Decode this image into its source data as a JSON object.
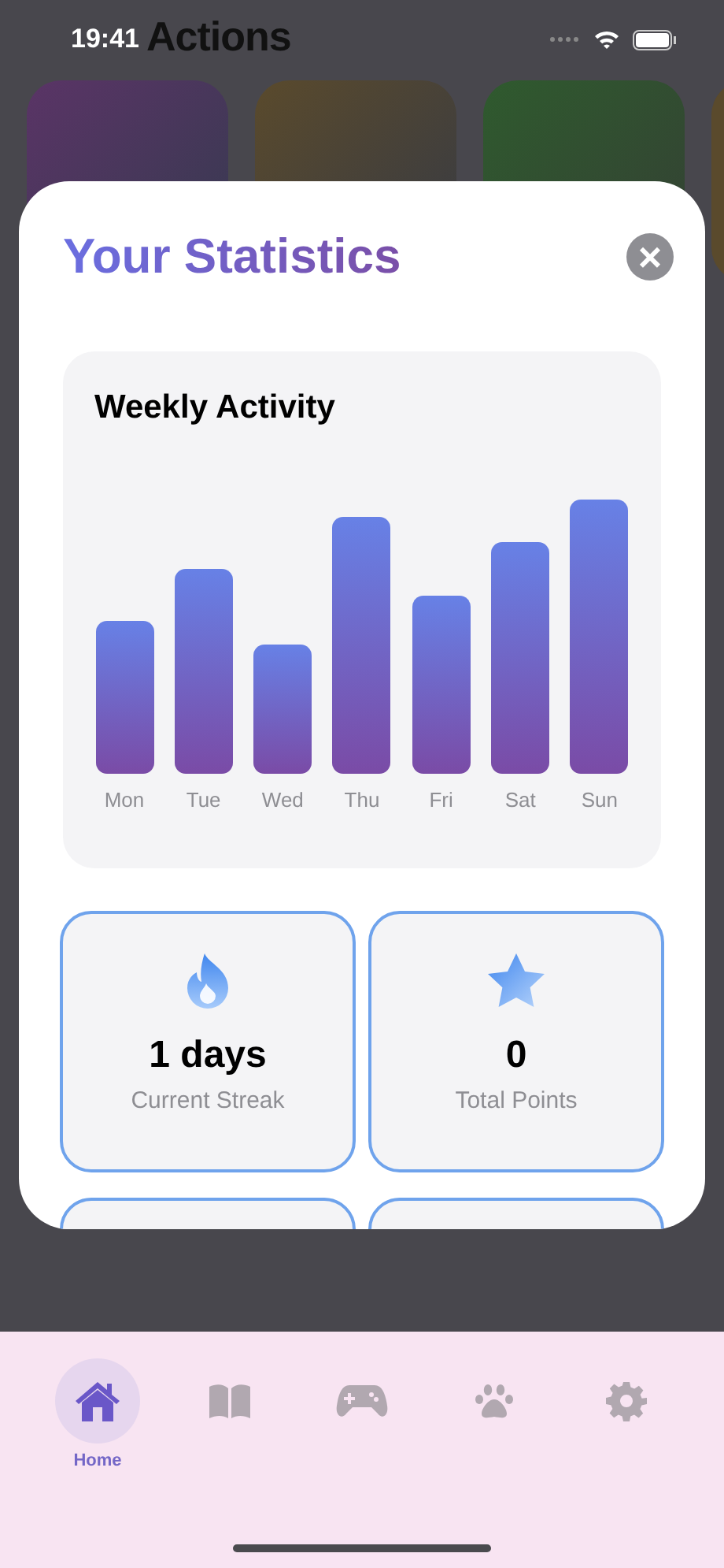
{
  "background": {
    "title": "Actions"
  },
  "status_bar": {
    "time": "19:41"
  },
  "modal": {
    "title": "Your Statistics",
    "close": "×",
    "chart": {
      "title": "Weekly Activity",
      "days": [
        "Mon",
        "Tue",
        "Wed",
        "Thu",
        "Fri",
        "Sat",
        "Sun"
      ]
    },
    "stats": [
      {
        "kind": "flame",
        "value": "1 days",
        "label": "Current Streak"
      },
      {
        "kind": "star",
        "value": "0",
        "label": "Total Points"
      }
    ]
  },
  "tabs": [
    {
      "kind": "home",
      "label": "Home",
      "selected": true
    },
    {
      "kind": "book",
      "selected": false
    },
    {
      "kind": "gamepad",
      "selected": false
    },
    {
      "kind": "paw",
      "selected": false
    },
    {
      "kind": "gear",
      "selected": false
    }
  ]
}
